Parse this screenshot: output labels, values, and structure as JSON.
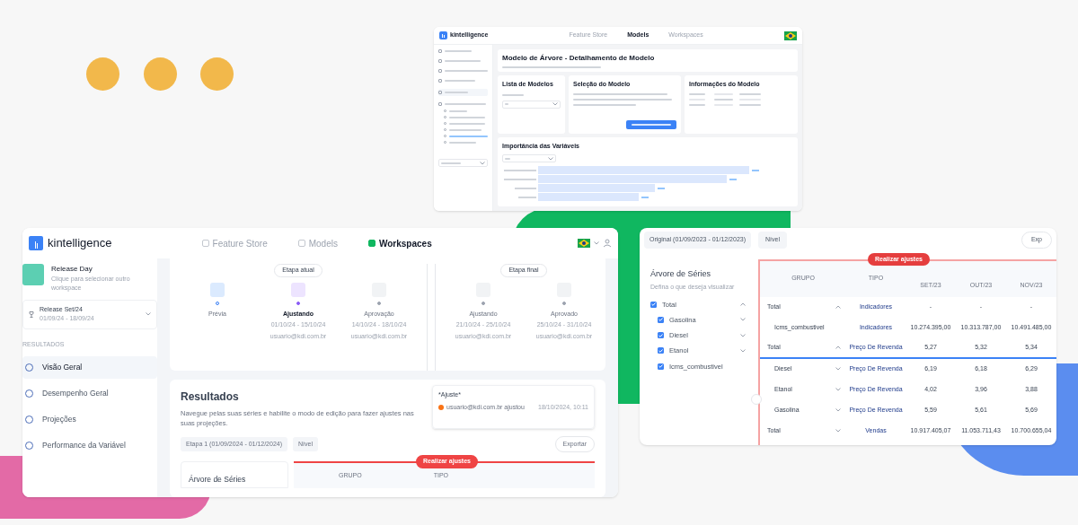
{
  "top_window": {
    "logo": "kintelligence",
    "nav": [
      {
        "label": "Feature Store",
        "selected": false
      },
      {
        "label": "Models",
        "selected": true
      },
      {
        "label": "Workspaces",
        "selected": false
      }
    ],
    "header": {
      "title": "Modelo de Árvore - Detalhamento de Modelo"
    },
    "models_card": {
      "title": "Lista de Modelos"
    },
    "selection_card": {
      "title": "Seleção do Modelo"
    },
    "info_card": {
      "title": "Informações do Modelo"
    },
    "importance": {
      "title": "Importância das Variáveis"
    }
  },
  "main_window": {
    "logo": "kintelligence",
    "nav": [
      {
        "label": "Feature Store",
        "selected": false
      },
      {
        "label": "Models",
        "selected": false
      },
      {
        "label": "Workspaces",
        "selected": true
      }
    ],
    "workspace": {
      "name": "Release Day",
      "hint": "Clique para selecionar outro workspace"
    },
    "release": {
      "name": "Release Set/24",
      "dates": "01/09/24 - 18/09/24"
    },
    "section": "RESULTADOS",
    "menu": [
      {
        "label": "Visão Geral",
        "selected": true
      },
      {
        "label": "Desempenho Geral",
        "selected": false
      },
      {
        "label": "Projeções",
        "selected": false
      },
      {
        "label": "Performance da Variável",
        "selected": false
      }
    ],
    "stage_groups": [
      {
        "tag": "Etapa atual",
        "steps": [
          {
            "label": "Prévia",
            "active": false
          },
          {
            "label": "Ajustando",
            "dates": "01/10/24 - 15/10/24",
            "user": "usuario@kdi.com.br",
            "active": true
          },
          {
            "label": "Aprovação",
            "dates": "14/10/24 - 18/10/24",
            "user": "usuario@kdi.com.br",
            "active": false
          }
        ]
      },
      {
        "tag": "Etapa final",
        "steps": [
          {
            "label": "Ajustando",
            "dates": "21/10/24 - 25/10/24",
            "user": "usuario@kdi.com.br",
            "active": false
          },
          {
            "label": "Aprovado",
            "dates": "25/10/24 - 31/10/24",
            "user": "usuario@kdi.com.br",
            "active": false
          }
        ]
      }
    ],
    "results": {
      "title": "Resultados",
      "text": "Navegue pelas suas séries e habilite o modo de edição para fazer ajustes nas suas projeções.",
      "comment": {
        "title": "*Ajuste*",
        "user": "usuario@kdi.com.br ajustou",
        "time": "18/10/2024, 10:11"
      },
      "period": "Etapa 1 (01/09/2024 - 01/12/2024)",
      "level": "Nível",
      "export": "Exportar",
      "edit_button": "Realizar ajustes",
      "tree_title": "Árvore de Séries",
      "columns": [
        "GRUPO",
        "TIPO"
      ]
    }
  },
  "side_window": {
    "period": "Original (01/09/2023 - 01/12/2023)",
    "level": "Nível",
    "export": "Exp",
    "tree": {
      "title": "Árvore de Séries",
      "subtitle": "Defina o que deseja visualizar",
      "items": [
        {
          "label": "Total",
          "checked": true,
          "expanded": true,
          "children": [
            {
              "label": "Gasolina",
              "checked": true,
              "expanded": false
            },
            {
              "label": "Diesel",
              "checked": true,
              "expanded": false
            },
            {
              "label": "Etanol",
              "checked": true,
              "expanded": false
            },
            {
              "label": "Icms_combustivel",
              "checked": true
            }
          ]
        }
      ]
    },
    "edit_button": "Realizar ajustes",
    "table": {
      "columns": [
        "GRUPO",
        "TIPO",
        "SET/23",
        "OUT/23",
        "NOV/23"
      ],
      "rows": [
        {
          "group": "Total",
          "expanded": true,
          "type": "Indicadores",
          "values": [
            "-",
            "-",
            "-"
          ],
          "selected": false,
          "children": [
            {
              "group": "Icms_combustivel",
              "type": "Indicadores",
              "values": [
                "10.274.395,00",
                "10.313.787,00",
                "10.491.485,00"
              ],
              "selected": false
            }
          ]
        },
        {
          "group": "Total",
          "expanded": true,
          "type": "Preço De Revenda",
          "values": [
            "5,27",
            "5,32",
            "5,34"
          ],
          "selected": true,
          "children": [
            {
              "group": "Diesel",
              "expanded": false,
              "type": "Preço De Revenda",
              "values": [
                "6,19",
                "6,18",
                "6,29"
              ],
              "selected": false
            },
            {
              "group": "Etanol",
              "expanded": false,
              "type": "Preço De Revenda",
              "values": [
                "4,02",
                "3,96",
                "3,88"
              ],
              "selected": false
            },
            {
              "group": "Gasolina",
              "expanded": false,
              "type": "Preço De Revenda",
              "values": [
                "5,59",
                "5,61",
                "5,69"
              ],
              "selected": false
            }
          ]
        },
        {
          "group": "Total",
          "expanded": false,
          "type": "Vendas",
          "values": [
            "10.917.405,07",
            "11.053.711,43",
            "10.700.655,04"
          ],
          "selected": false
        }
      ]
    }
  }
}
